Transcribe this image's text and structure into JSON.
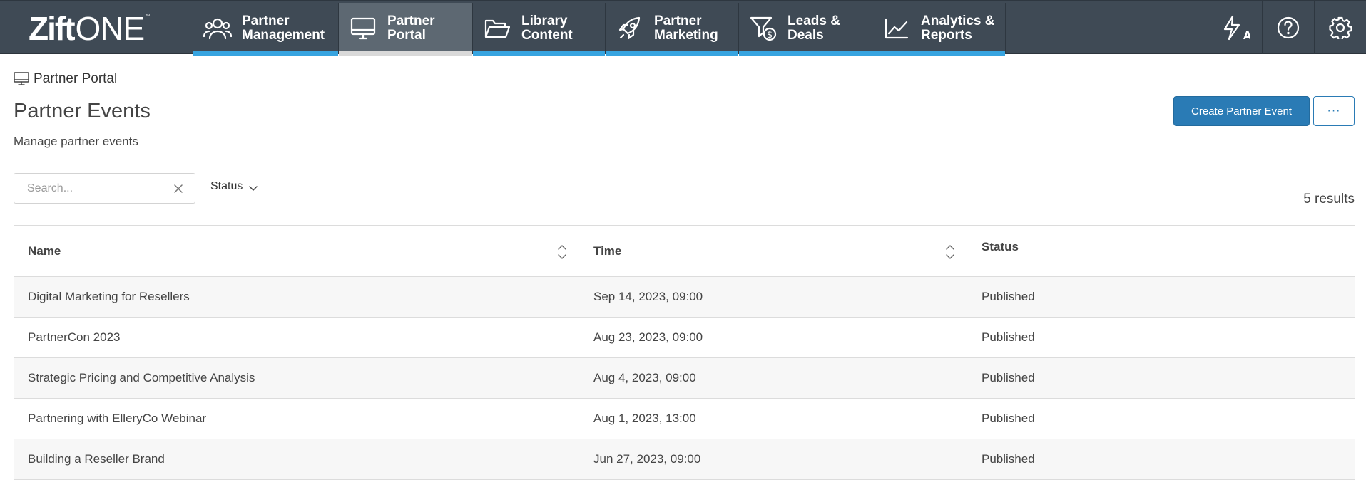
{
  "brand": {
    "logo_bold": "Zift",
    "logo_light": "ONE",
    "logo_tm": "™"
  },
  "nav": [
    {
      "label": "Partner\nManagement",
      "icon": "users-icon",
      "active": false
    },
    {
      "label": "Partner\nPortal",
      "icon": "monitor-icon",
      "active": true
    },
    {
      "label": "Library\nContent",
      "icon": "folder-open-icon",
      "active": false
    },
    {
      "label": "Partner\nMarketing",
      "icon": "rocket-icon",
      "active": false
    },
    {
      "label": "Leads &\nDeals",
      "icon": "funnel-dollar-icon",
      "active": false
    },
    {
      "label": "Analytics &\nReports",
      "icon": "line-chart-icon",
      "active": false
    }
  ],
  "toolbar_icons": [
    "translate-icon",
    "help-icon",
    "gear-icon"
  ],
  "breadcrumb": {
    "label": "Partner Portal",
    "icon": "monitor-icon"
  },
  "page": {
    "title": "Partner Events",
    "subtitle": "Manage partner events",
    "create_button": "Create Partner Event",
    "more_button": "···"
  },
  "filters": {
    "search_placeholder": "Search...",
    "status_label": "Status",
    "results_text": "5 results"
  },
  "table": {
    "columns": {
      "name": "Name",
      "time": "Time",
      "status": "Status"
    },
    "rows": [
      {
        "name": "Digital Marketing for Resellers",
        "time": "Sep 14, 2023, 09:00",
        "status": "Published"
      },
      {
        "name": "PartnerCon 2023",
        "time": "Aug 23, 2023, 09:00",
        "status": "Published"
      },
      {
        "name": "Strategic Pricing and Competitive Analysis",
        "time": "Aug 4, 2023, 09:00",
        "status": "Published"
      },
      {
        "name": "Partnering with ElleryCo Webinar",
        "time": "Aug 1, 2023, 13:00",
        "status": "Published"
      },
      {
        "name": "Building a Reseller Brand",
        "time": "Jun 27, 2023, 09:00",
        "status": "Published"
      }
    ]
  },
  "colors": {
    "nav_bg": "#3f4a55",
    "nav_accent": "#37a4e0",
    "primary": "#2a7bb5"
  }
}
